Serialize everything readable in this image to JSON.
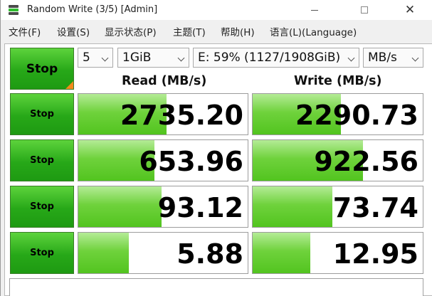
{
  "window": {
    "title": "Random Write (3/5) [Admin]",
    "controls": {
      "minimize": "minimize",
      "maximize": "maximize",
      "close": "✕"
    }
  },
  "menu": [
    "文件(F)",
    "设置(S)",
    "显示状态(P)",
    "主题(T)",
    "帮助(H)",
    "语言(L)(Language)"
  ],
  "toolbar": {
    "all_button": "Stop",
    "count": "5",
    "size": "1GiB",
    "drive": "E: 59% (1127/1908GiB)",
    "unit": "MB/s"
  },
  "headers": {
    "read": "Read (MB/s)",
    "write": "Write (MB/s)"
  },
  "rows": [
    {
      "button": "Stop",
      "read": "2735.20",
      "write": "2290.73",
      "read_fill": 0.52,
      "write_fill": 0.52
    },
    {
      "button": "Stop",
      "read": "653.96",
      "write": "922.56",
      "read_fill": 0.45,
      "write_fill": 0.65
    },
    {
      "button": "Stop",
      "read": "93.12",
      "write": "73.74",
      "read_fill": 0.49,
      "write_fill": 0.47
    },
    {
      "button": "Stop",
      "read": "5.88",
      "write": "12.95",
      "read_fill": 0.3,
      "write_fill": 0.34
    }
  ],
  "colors": {
    "button_green": "#27a818",
    "bar_green": "#6fd23c",
    "corner_orange": "#f48a1d"
  }
}
